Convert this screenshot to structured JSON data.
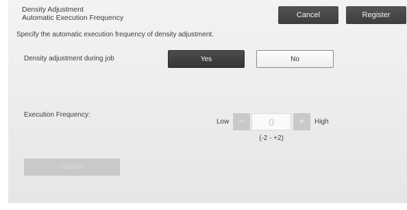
{
  "header": {
    "title_line1": "Density Adjustment",
    "title_line2": "Automatic Execution Frequency",
    "cancel_label": "Cancel",
    "register_label": "Register"
  },
  "description": "Specify the automatic execution frequency of density adjustment.",
  "density_during_job": {
    "label": "Density adjustment during job",
    "options": [
      "Yes",
      "No"
    ],
    "selected": "Yes"
  },
  "execution_frequency": {
    "label": "Execution Frequency:",
    "low_label": "Low",
    "high_label": "High",
    "minus_label": "−",
    "plus_label": "+",
    "value": "0",
    "range": "(-2 - +2)"
  },
  "custom_button": {
    "label": "Custom"
  },
  "colors": {
    "selected_button": "#3f3f3f",
    "disabled_control": "#c9c9c9",
    "panel_background": "#ececec"
  }
}
